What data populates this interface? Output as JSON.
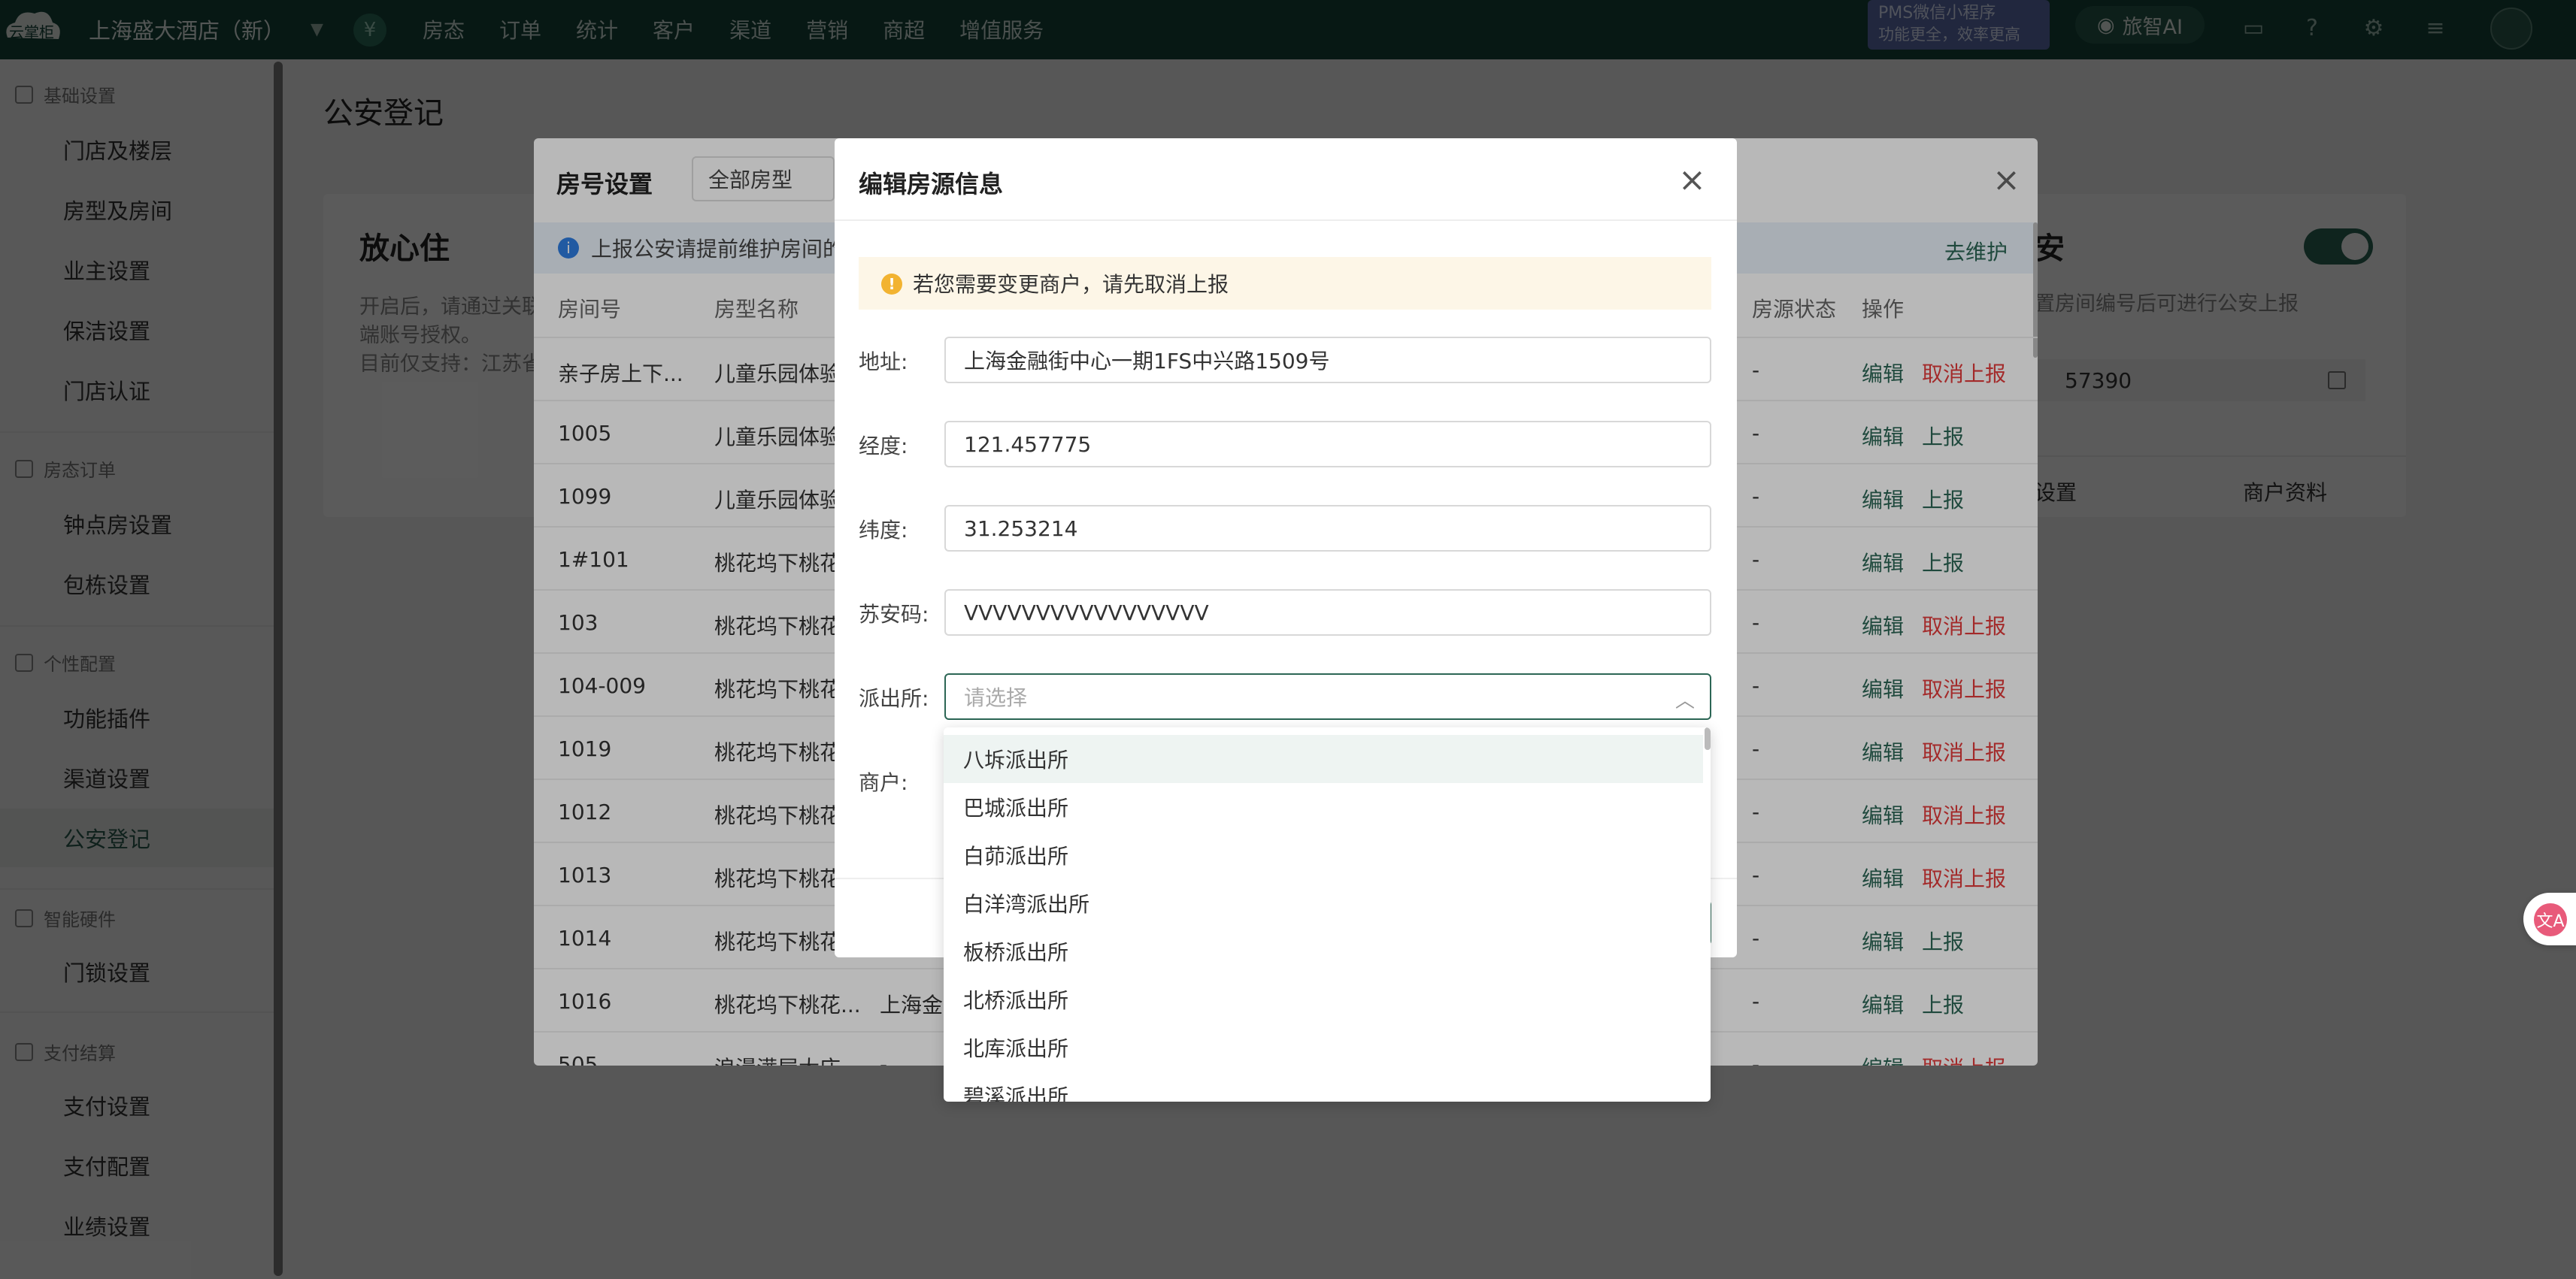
{
  "topbar": {
    "logo_text": "云掌柜",
    "store_name": "上海盛大酒店（新）",
    "nav": [
      "房态",
      "订单",
      "统计",
      "客户",
      "渠道",
      "营销",
      "商超",
      "增值服务"
    ],
    "pms_line1": "PMS微信小程序",
    "pms_line2": "功能更全，效率更高",
    "ai_label": "旅智AI"
  },
  "sidebar": {
    "sections": [
      {
        "title": "基础设置",
        "items": [
          "门店及楼层",
          "房型及房间",
          "业主设置",
          "保洁设置",
          "门店认证"
        ]
      },
      {
        "title": "房态订单",
        "items": [
          "钟点房设置",
          "包栋设置"
        ]
      },
      {
        "title": "个性配置",
        "items": [
          "功能插件",
          "渠道设置",
          "公安登记"
        ]
      },
      {
        "title": "智能硬件",
        "items": [
          "门锁设置"
        ]
      },
      {
        "title": "支付结算",
        "items": [
          "支付设置",
          "支付配置",
          "业绩设置"
        ]
      }
    ],
    "active": "公安登记"
  },
  "main": {
    "page_title": "公安登记",
    "card1": {
      "title": "放心住",
      "desc_line1": "开启后，请通过关联",
      "desc_line2": "端账号授权。",
      "desc_line3": "目前仅支持：江苏省"
    },
    "card2": {
      "title": "安",
      "desc": "置房间编号后可进行公安上报",
      "code": "57390",
      "foot_left": "设置",
      "foot_right": "商户资料"
    }
  },
  "room_dialog": {
    "title": "房号设置",
    "filter_value": "全部房型",
    "info_text": "上报公安请提前维护房间的",
    "maintain_link": "去维护",
    "columns": {
      "room_no": "房间号",
      "room_type": "房型名称",
      "status": "房源状态",
      "ops": "操作"
    },
    "rows": [
      {
        "room": "亲子房上下...",
        "type": "儿童乐园体验",
        "addr": "",
        "status": "-",
        "edit": "编辑",
        "action": "取消上报"
      },
      {
        "room": "1005",
        "type": "儿童乐园体验",
        "addr": "",
        "status": "-",
        "edit": "编辑",
        "action": "上报"
      },
      {
        "room": "1099",
        "type": "儿童乐园体验",
        "addr": "",
        "status": "-",
        "edit": "编辑",
        "action": "上报"
      },
      {
        "room": "1#101",
        "type": "桃花坞下桃花",
        "addr": "",
        "status": "-",
        "edit": "编辑",
        "action": "上报"
      },
      {
        "room": "103",
        "type": "桃花坞下桃花",
        "addr": "",
        "status": "-",
        "edit": "编辑",
        "action": "取消上报"
      },
      {
        "room": "104-009",
        "type": "桃花坞下桃花",
        "addr": "",
        "status": "-",
        "edit": "编辑",
        "action": "取消上报"
      },
      {
        "room": "1019",
        "type": "桃花坞下桃花",
        "addr": "",
        "status": "-",
        "edit": "编辑",
        "action": "取消上报"
      },
      {
        "room": "1012",
        "type": "桃花坞下桃花",
        "addr": "",
        "status": "-",
        "edit": "编辑",
        "action": "取消上报"
      },
      {
        "room": "1013",
        "type": "桃花坞下桃花",
        "addr": "",
        "status": "-",
        "edit": "编辑",
        "action": "取消上报"
      },
      {
        "room": "1014",
        "type": "桃花坞下桃花",
        "addr": "",
        "status": "-",
        "edit": "编辑",
        "action": "上报"
      },
      {
        "room": "1016",
        "type": "桃花坞下桃花...",
        "addr": "上海金",
        "status": "-",
        "edit": "编辑",
        "action": "上报"
      },
      {
        "room": "505",
        "type": "浪漫满屋大床...",
        "addr": "-",
        "status": "-",
        "edit": "编辑",
        "action": "取消上报"
      }
    ]
  },
  "edit_dialog": {
    "title": "编辑房源信息",
    "warning": "若您需要变更商户，请先取消上报",
    "fields": {
      "address_label": "地址:",
      "address_value": "上海金融街中心一期1FS中兴路1509号",
      "lng_label": "经度:",
      "lng_value": "121.457775",
      "lat_label": "纬度:",
      "lat_value": "31.253214",
      "suan_label": "苏安码:",
      "suan_value": "VVVVVVVVVVVVVVVVV",
      "police_label": "派出所:",
      "police_placeholder": "请选择",
      "merchant_label": "商户:"
    }
  },
  "dropdown": {
    "options": [
      "八坼派出所",
      "巴城派出所",
      "白茆派出所",
      "白洋湾派出所",
      "板桥派出所",
      "北桥派出所",
      "北库派出所",
      "碧溪派出所"
    ]
  },
  "colors": {
    "brand": "#15453a",
    "accent": "#2c6655",
    "danger": "#e23b3b",
    "warning_bg": "#fdf6e7"
  }
}
